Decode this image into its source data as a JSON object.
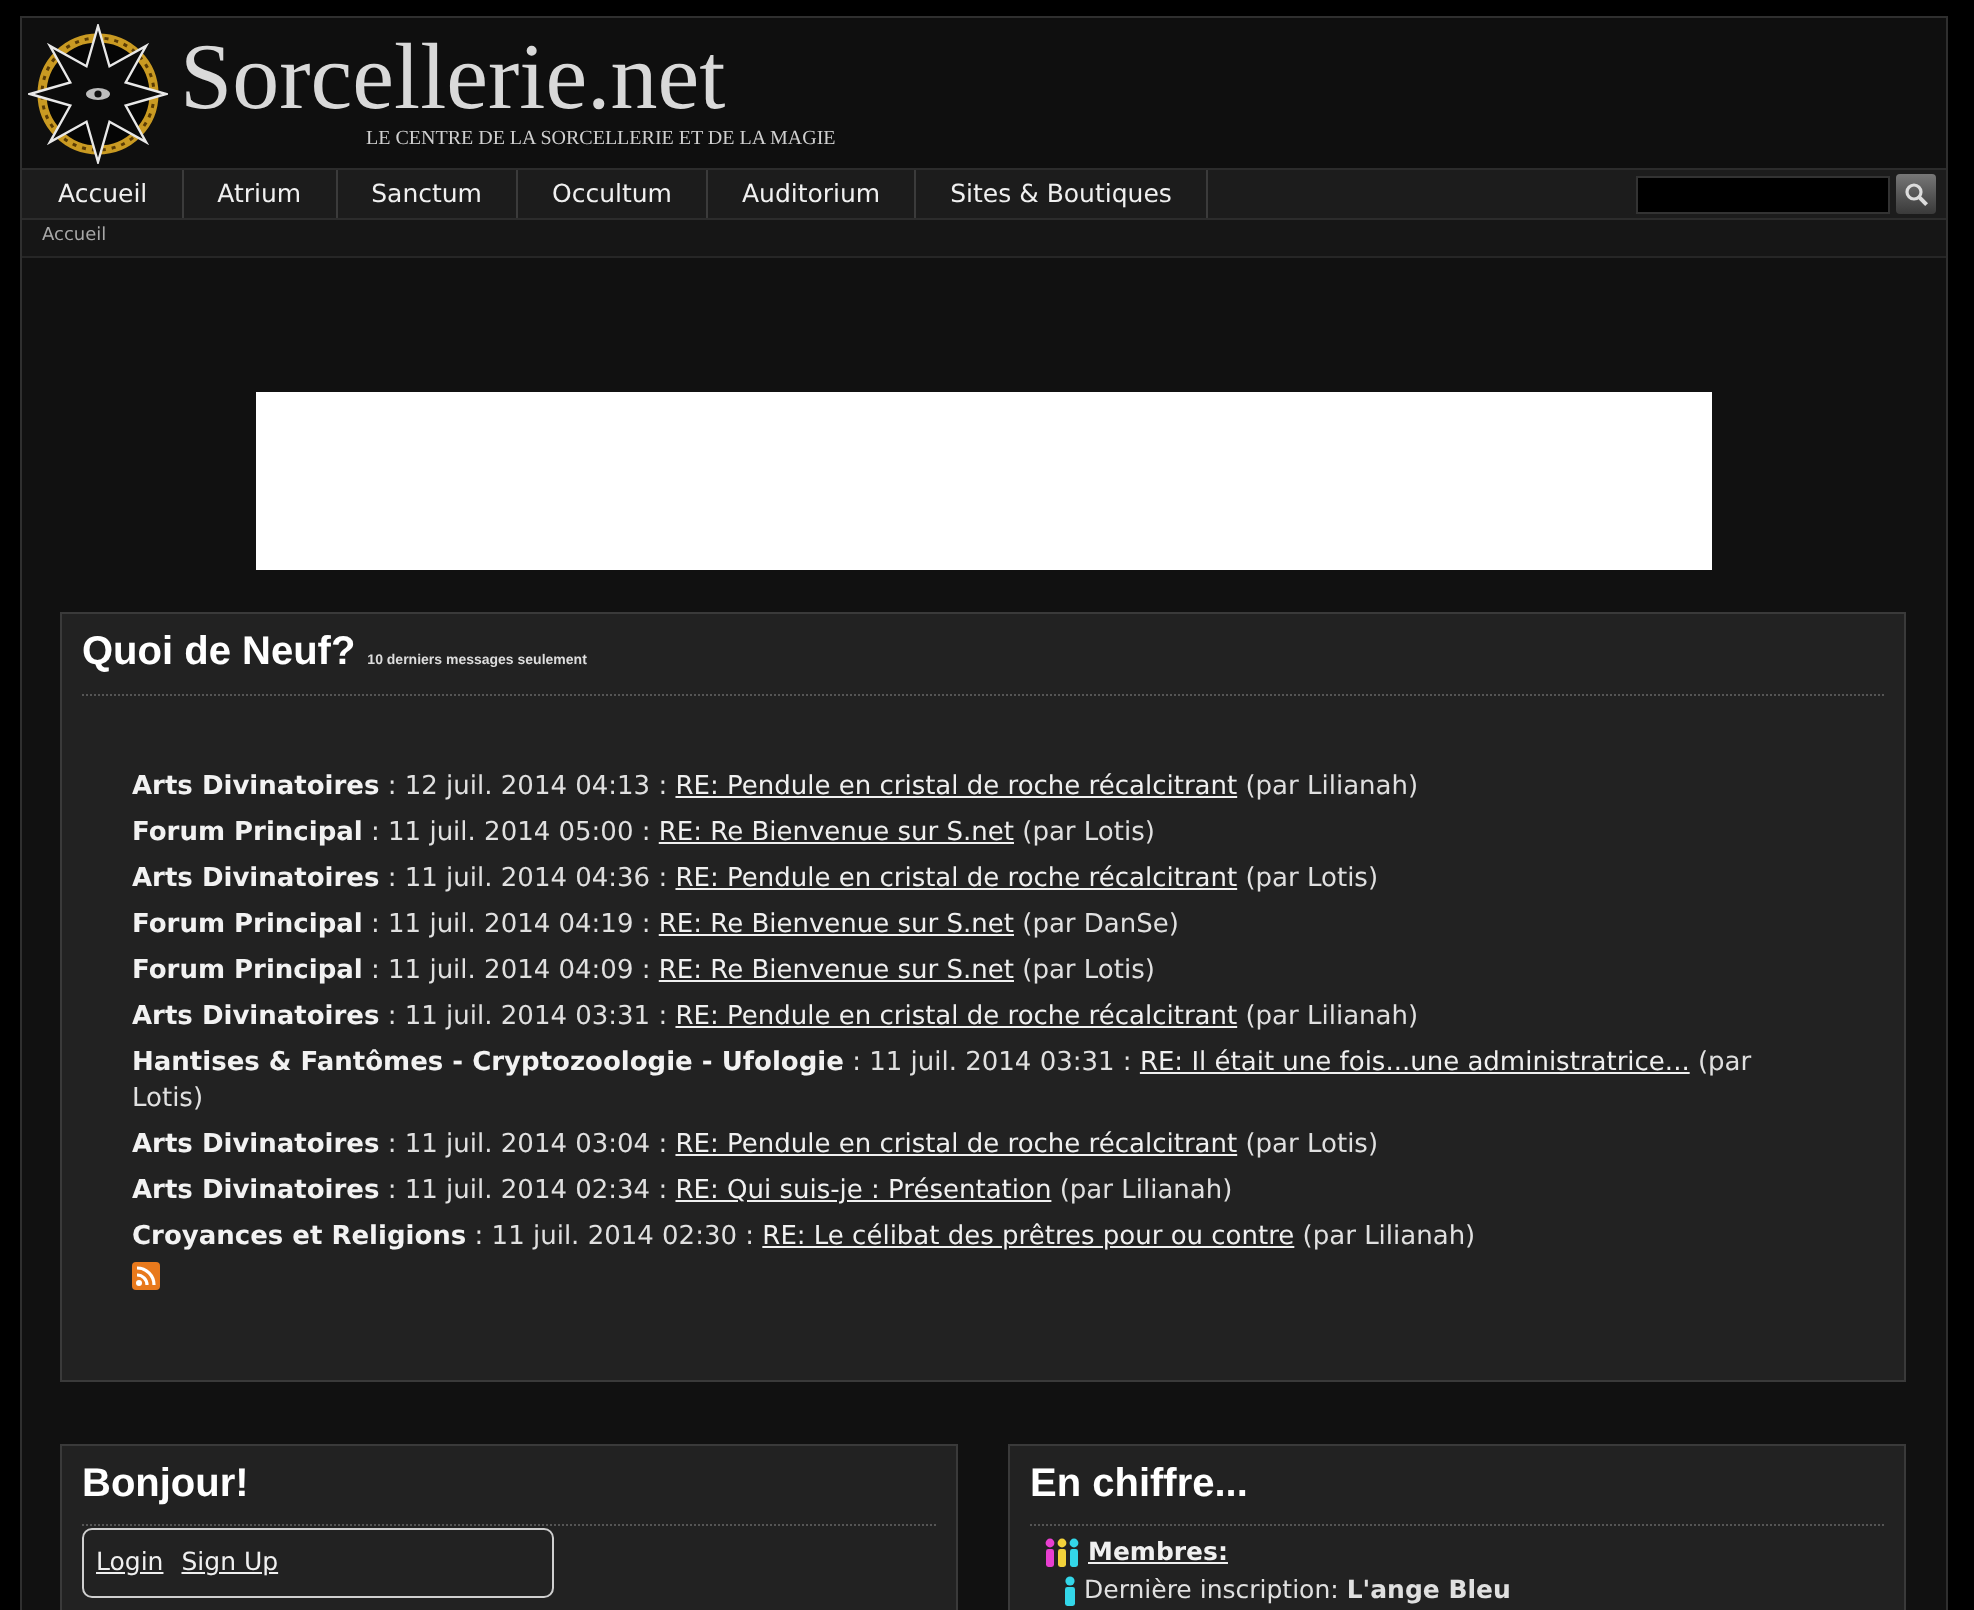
{
  "header": {
    "site_title": "Sorcellerie.net",
    "tagline": "LE CENTRE DE LA SORCELLERIE ET DE LA MAGIE"
  },
  "nav": {
    "items": [
      "Accueil",
      "Atrium",
      "Sanctum",
      "Occultum",
      "Auditorium",
      "Sites & Boutiques"
    ]
  },
  "breadcrumb": [
    "Accueil"
  ],
  "news": {
    "title": "Quoi de Neuf?",
    "subtitle": "10 derniers messages seulement",
    "posts": [
      {
        "forum": "Arts Divinatoires",
        "date": ": 12 juil. 2014 04:13 :",
        "topic": "RE: Pendule en cristal de roche récalcitrant",
        "author": "(par Lilianah)"
      },
      {
        "forum": "Forum Principal",
        "date": ": 11 juil. 2014 05:00 :",
        "topic": "RE: Re Bienvenue sur S.net",
        "author": "(par Lotis)"
      },
      {
        "forum": "Arts Divinatoires",
        "date": ": 11 juil. 2014 04:36 :",
        "topic": "RE: Pendule en cristal de roche récalcitrant",
        "author": "(par Lotis)"
      },
      {
        "forum": "Forum Principal",
        "date": ": 11 juil. 2014 04:19 :",
        "topic": "RE: Re Bienvenue sur S.net",
        "author": "(par DanSe)"
      },
      {
        "forum": "Forum Principal",
        "date": ": 11 juil. 2014 04:09 :",
        "topic": "RE: Re Bienvenue sur S.net",
        "author": "(par Lotis)"
      },
      {
        "forum": "Arts Divinatoires",
        "date": ": 11 juil. 2014 03:31 :",
        "topic": "RE: Pendule en cristal de roche récalcitrant",
        "author": "(par Lilianah)"
      },
      {
        "forum": "Hantises & Fantômes - Cryptozoologie - Ufologie",
        "date": ": 11 juil. 2014 03:31 :",
        "topic": "RE: Il était une fois...une administratrice...",
        "author": "(par Lotis)"
      },
      {
        "forum": "Arts Divinatoires",
        "date": ": 11 juil. 2014 03:04 :",
        "topic": "RE: Pendule en cristal de roche récalcitrant",
        "author": "(par Lotis)"
      },
      {
        "forum": "Arts Divinatoires",
        "date": ": 11 juil. 2014 02:34 :",
        "topic": "RE: Qui suis-je : Présentation",
        "author": "(par Lilianah)"
      },
      {
        "forum": "Croyances et Religions",
        "date": ": 11 juil. 2014 02:30 :",
        "topic": "RE: Le célibat des prêtres pour ou contre",
        "author": "(par Lilianah)"
      }
    ]
  },
  "welcome": {
    "title": "Bonjour!",
    "links": [
      "Login",
      "Sign Up"
    ]
  },
  "stats": {
    "title": "En chiffre...",
    "members_link": "Membres:",
    "latest": "Dernière inscription: **L'ange Bleu**"
  }
}
